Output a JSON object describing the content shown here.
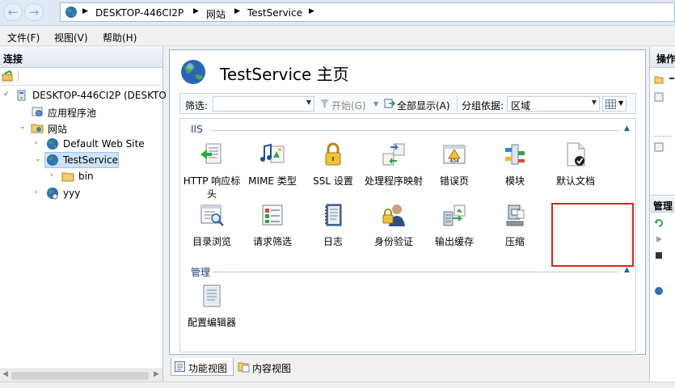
{
  "address": {
    "crumbs": [
      "DESKTOP-446CI2P",
      "网站",
      "TestService"
    ]
  },
  "menu": {
    "items": [
      "文件(F)",
      "视图(V)",
      "帮助(H)"
    ]
  },
  "left": {
    "header": "连接",
    "tree": {
      "server": "DESKTOP-446CI2P (DESKTOP",
      "app_pools": "应用程序池",
      "sites": "网站",
      "default_site": "Default Web Site",
      "test_service": "TestService",
      "bin": "bin",
      "yyy": "yyy"
    }
  },
  "main": {
    "title": "TestService 主页",
    "filter_label": "筛选:",
    "start_label": "开始(G)",
    "show_all_label": "全部显示(A)",
    "group_by_label": "分组依据:",
    "group_by_value": "区域",
    "groups": [
      {
        "name": "IIS",
        "features": [
          {
            "label": "HTTP 响应标头",
            "icon": "http-headers-icon"
          },
          {
            "label": "MIME 类型",
            "icon": "mime-types-icon"
          },
          {
            "label": "SSL 设置",
            "icon": "ssl-lock-icon"
          },
          {
            "label": "处理程序映射",
            "icon": "handler-mappings-icon"
          },
          {
            "label": "错误页",
            "icon": "error-pages-icon"
          },
          {
            "label": "模块",
            "icon": "modules-icon"
          },
          {
            "label": "默认文档",
            "icon": "default-document-icon"
          },
          {
            "label": "目录浏览",
            "icon": "directory-browsing-icon"
          },
          {
            "label": "请求筛选",
            "icon": "request-filtering-icon"
          },
          {
            "label": "日志",
            "icon": "logging-icon"
          },
          {
            "label": "身份验证",
            "icon": "authentication-icon"
          },
          {
            "label": "输出缓存",
            "icon": "output-caching-icon"
          },
          {
            "label": "压缩",
            "icon": "compression-icon"
          }
        ]
      },
      {
        "name": "管理",
        "features": [
          {
            "label": "配置编辑器",
            "icon": "configuration-editor-icon"
          }
        ]
      }
    ],
    "view_tabs": [
      "功能视图",
      "内容视图"
    ]
  },
  "right": {
    "header": "操作",
    "section2": "管理"
  },
  "colors": {
    "highlight": "#e0221d",
    "accent": "#1e3a7a"
  }
}
